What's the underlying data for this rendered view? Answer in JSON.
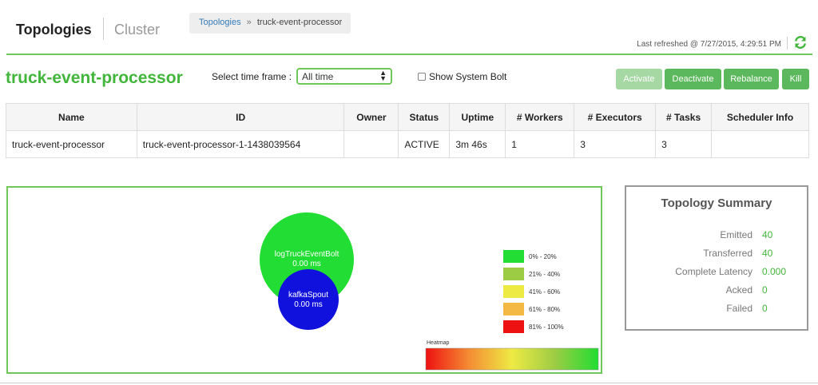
{
  "nav": {
    "topologies": "Topologies",
    "cluster": "Cluster"
  },
  "breadcrumb": {
    "link": "Topologies",
    "separator": "»",
    "current": "truck-event-processor"
  },
  "refresh": {
    "text": "Last refreshed @ 7/27/2015, 4:29:51 PM",
    "icon": "refresh-icon"
  },
  "topology": {
    "title": "truck-event-processor"
  },
  "controls": {
    "timeframe_label": "Select time frame :",
    "timeframe_value": "All time",
    "system_bolt_label": "Show System Bolt"
  },
  "actions": {
    "activate": "Activate",
    "deactivate": "Deactivate",
    "rebalance": "Rebalance",
    "kill": "Kill"
  },
  "table": {
    "headers": [
      "Name",
      "ID",
      "Owner",
      "Status",
      "Uptime",
      "# Workers",
      "# Executors",
      "# Tasks",
      "Scheduler Info"
    ],
    "rows": [
      [
        "truck-event-processor",
        "truck-event-processor-1-1438039564",
        "",
        "ACTIVE",
        "3m 46s",
        "1",
        "3",
        "3",
        ""
      ]
    ]
  },
  "graph": {
    "nodes": [
      {
        "name": "logTruckEventBolt",
        "latency": "0.00 ms",
        "color": "#22dd33"
      },
      {
        "name": "kafkaSpout",
        "latency": "0.00 ms",
        "color": "#1111dd"
      }
    ],
    "legend": [
      {
        "label": "0% - 20%",
        "color": "#22dd33"
      },
      {
        "label": "21% - 40%",
        "color": "#9ccc44"
      },
      {
        "label": "41% - 60%",
        "color": "#eeea44"
      },
      {
        "label": "61% - 80%",
        "color": "#f4b844"
      },
      {
        "label": "81% - 100%",
        "color": "#ee1111"
      }
    ],
    "heatmap_label": "Heatmap"
  },
  "summary": {
    "title": "Topology Summary",
    "stats": [
      {
        "label": "Emitted",
        "value": "40"
      },
      {
        "label": "Transferred",
        "value": "40"
      },
      {
        "label": "Complete Latency",
        "value": "0.000"
      },
      {
        "label": "Acked",
        "value": "0"
      },
      {
        "label": "Failed",
        "value": "0"
      }
    ]
  },
  "colors": {
    "accent": "#41b63a",
    "border_green": "#6fc75a",
    "button_green": "#5cb85c"
  }
}
